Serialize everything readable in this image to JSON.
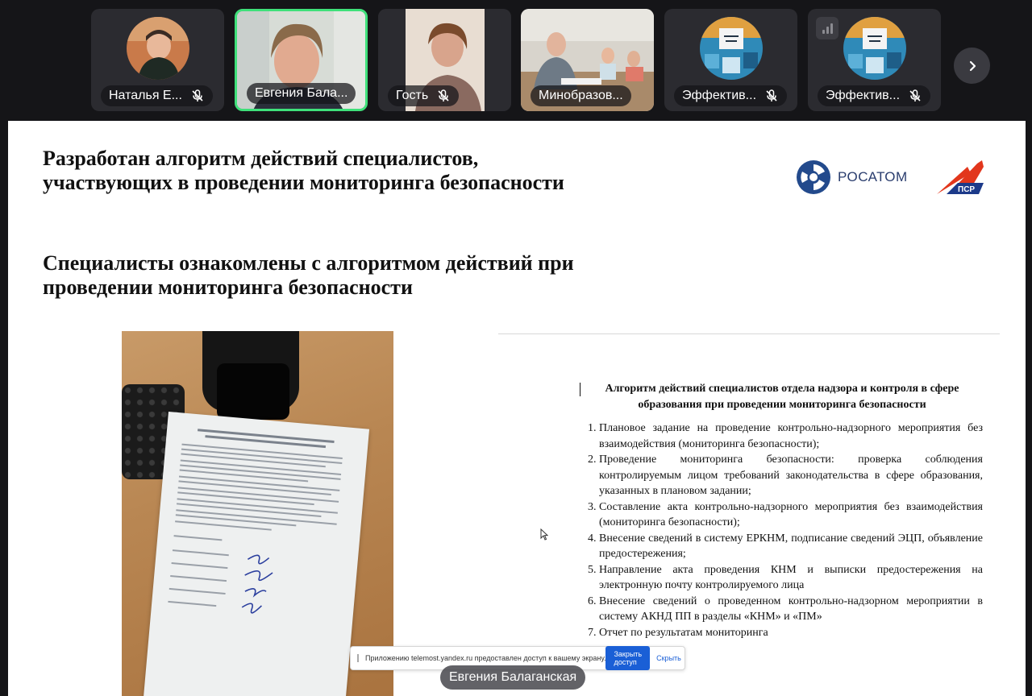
{
  "participants": [
    {
      "name": "Наталья Е...",
      "muted": true
    },
    {
      "name": "Евгения Бала...",
      "muted": false
    },
    {
      "name": "Гость",
      "muted": true
    },
    {
      "name": "Минобразов...",
      "muted": false
    },
    {
      "name": "Эффектив...",
      "muted": true
    },
    {
      "name": "Эффектив...",
      "muted": true
    }
  ],
  "colors": {
    "active_speaker_border": "#3fe07a",
    "stop_button": "#1a5fd6",
    "background": "#151518"
  },
  "icons": {
    "next": "chevron-right-icon",
    "mic": "mic-off-icon",
    "signal": "signal-bars-icon"
  },
  "slide": {
    "title_line1": "Разработан алгоритм действий специалистов,",
    "title_line2": "участвующих в проведении мониторинга безопасности",
    "subtitle_line1": "Специалисты ознакомлены с алгоритмом действий при",
    "subtitle_line2": "проведении мониторинга безопасности",
    "logo_rosatom": "РОСАТОМ",
    "document": {
      "title_line1": "Алгоритм действий специалистов отдела надзора и контроля в сфере",
      "title_line2": "образования при проведении мониторинга безопасности",
      "items": [
        "Плановое задание на проведение контрольно-надзорного мероприятия без взаимодействия (мониторинга безопасности);",
        "Проведение мониторинга безопасности: проверка соблюдения контролируемым лицом требований законодательства в сфере образования, указанных в плановом задании;",
        "Составление акта контрольно-надзорного мероприятия без взаимодействия (мониторинга безопасности);",
        "Внесение сведений в систему ЕРКНМ, подписание сведений ЭЦП, объявление предостережения;",
        "Направление акта проведения КНМ и выписки предостережения на электронную почту контролируемого лица",
        "Внесение сведений о проведенном контрольно-надзорном мероприятии в систему АКНД ПП в разделы «КНМ» и «ПМ»",
        "Отчет по результатам мониторинга"
      ]
    }
  },
  "share_notice": {
    "message": "Приложению telemost.yandex.ru предоставлен доступ к вашему экрану.",
    "stop_label": "Закрыть доступ",
    "hide_label": "Скрыть"
  },
  "speaker_label": "Евгения Балаганская"
}
